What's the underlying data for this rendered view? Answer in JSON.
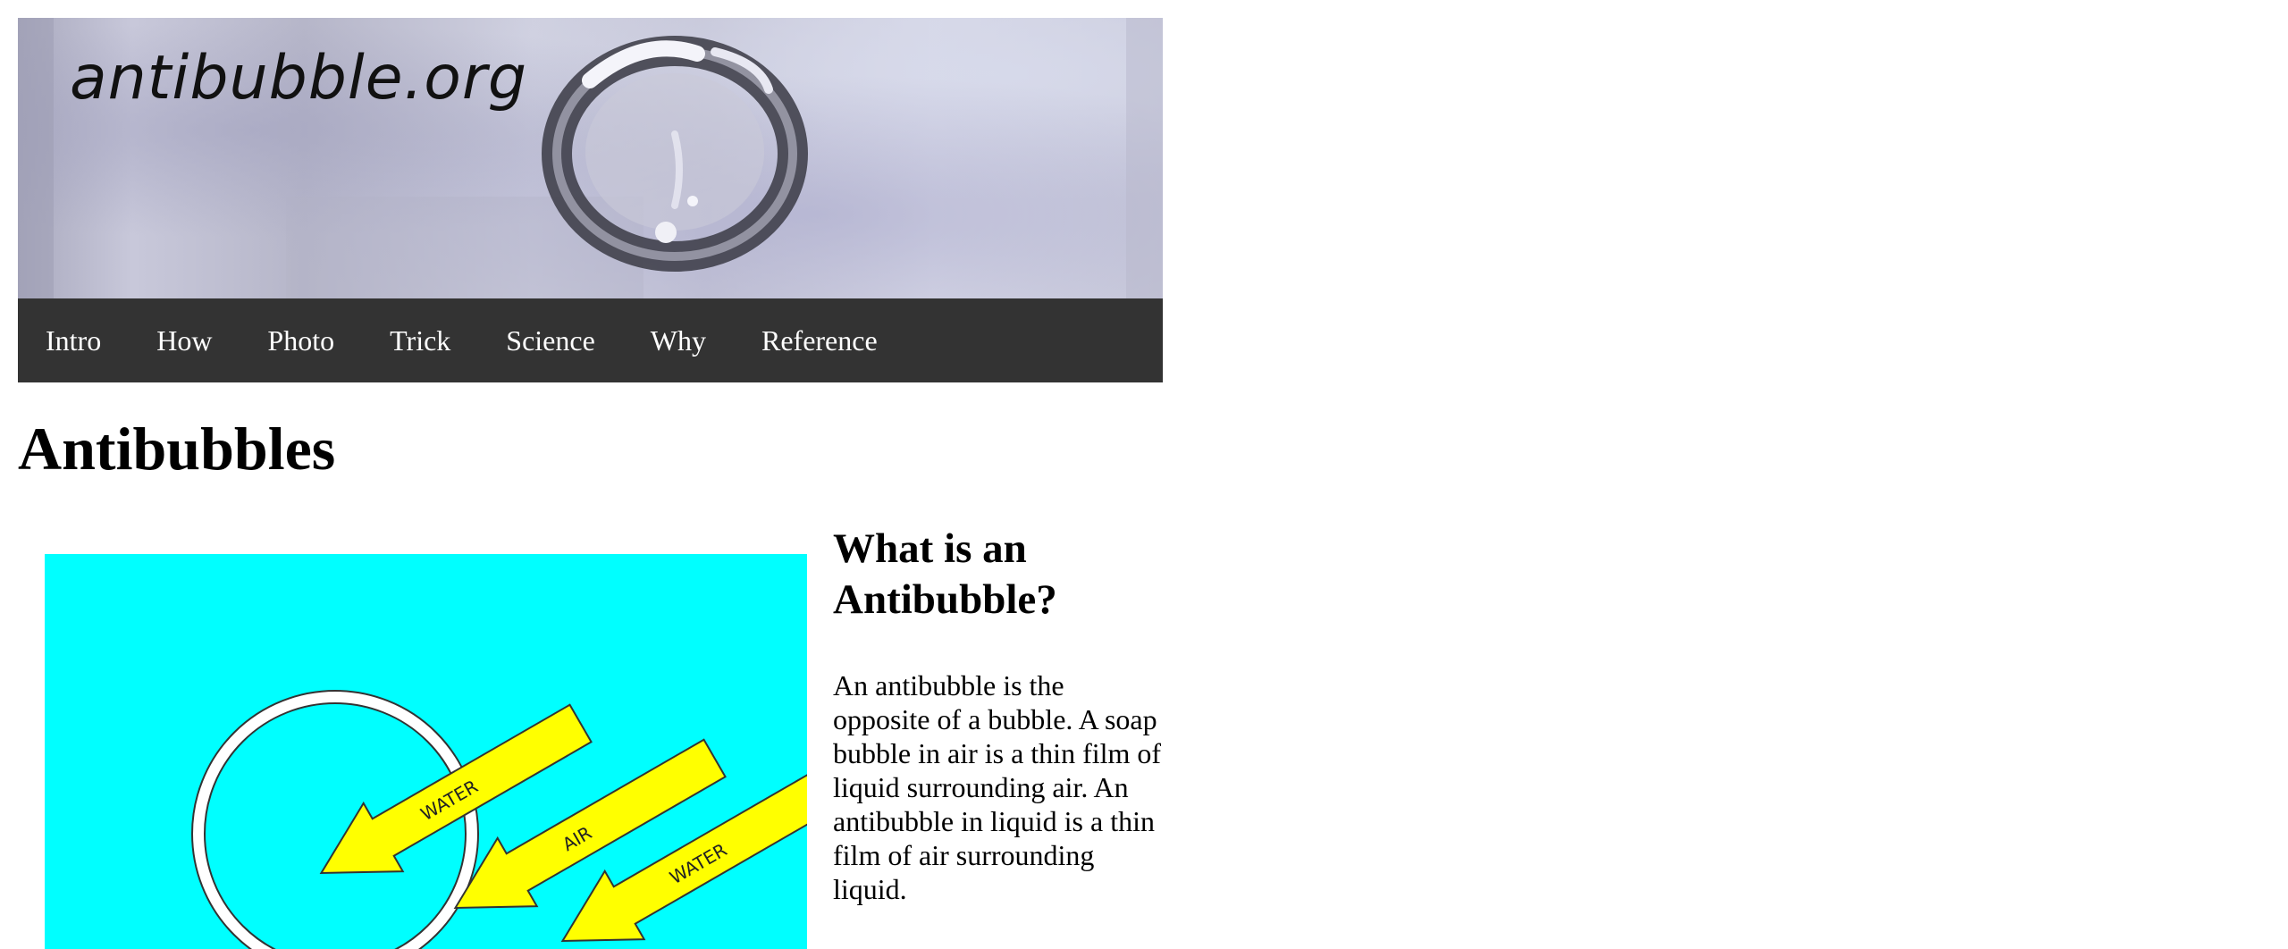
{
  "banner": {
    "logo_text": "antibubble.org"
  },
  "nav": {
    "items": [
      {
        "label": "Intro"
      },
      {
        "label": "How"
      },
      {
        "label": "Photo"
      },
      {
        "label": "Trick"
      },
      {
        "label": "Science"
      },
      {
        "label": "Why"
      },
      {
        "label": "Reference"
      }
    ]
  },
  "main": {
    "title": "Antibubbles",
    "diagram": {
      "background_color": "#00ffff",
      "arrow_color": "#ffff00",
      "arrow_labels": [
        "WATER",
        "AIR",
        "WATER"
      ]
    },
    "section_heading": "What is an Antibubble?",
    "paragraph": "An antibubble is the opposite of a bubble. A soap bubble in air is a thin film of liquid surrounding air. An antibubble in liquid is a thin film of air surrounding liquid."
  },
  "colors": {
    "nav_background": "#333333",
    "nav_text": "#ffffff"
  }
}
